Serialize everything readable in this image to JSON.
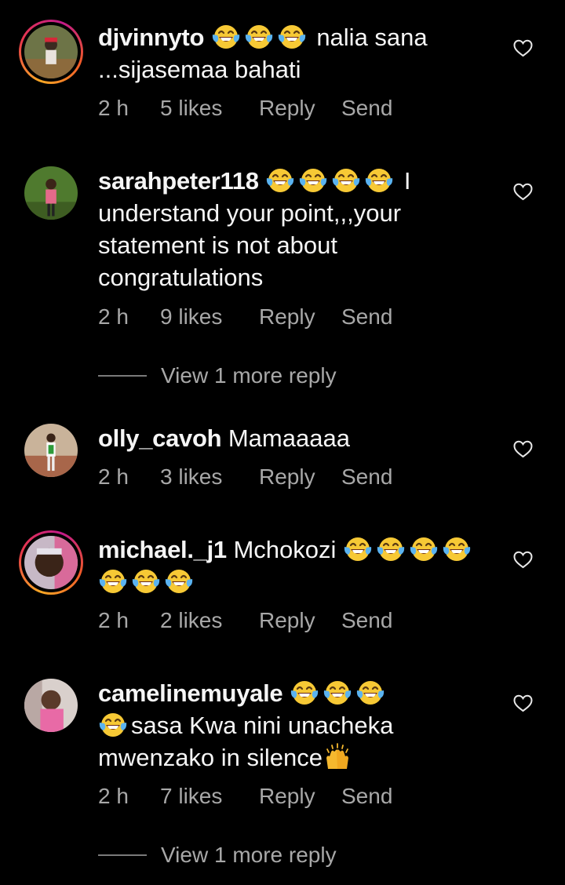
{
  "comments": [
    {
      "username": "djvinnyto",
      "text_before": "",
      "emojis_inline": 3,
      "text": " nalia sana ...sijasemaa bahati",
      "time": "2 h",
      "likes": "5 likes",
      "reply": "Reply",
      "send": "Send",
      "has_story_ring": true
    },
    {
      "username": "sarahpeter118",
      "emojis_inline": 4,
      "text": " I understand your point,,,your statement is not about congratulations",
      "time": "2 h",
      "likes": "9 likes",
      "reply": "Reply",
      "send": "Send",
      "view_more": "View 1 more reply",
      "has_story_ring": false
    },
    {
      "username": "olly_cavoh",
      "text": " Mamaaaaa",
      "time": "2 h",
      "likes": "3 likes",
      "reply": "Reply",
      "send": "Send",
      "has_story_ring": false
    },
    {
      "username": "michael._j1",
      "text": " Mchokozi ",
      "time": "2 h",
      "likes": "2 likes",
      "reply": "Reply",
      "send": "Send",
      "has_story_ring": true
    },
    {
      "username": "camelinemuyale",
      "text": "sasa Kwa nini unacheka mwenzako in silence",
      "time": "2 h",
      "likes": "7 likes",
      "reply": "Reply",
      "send": "Send",
      "view_more": "View 1 more reply",
      "has_story_ring": false
    }
  ],
  "icons": {
    "like": "heart-outline-icon",
    "laugh": "face-with-tears-of-joy-emoji",
    "praise": "raising-hands-emoji"
  },
  "colors": {
    "background": "#000000",
    "text": "#f5f5f5",
    "secondary": "#a8a8a8"
  }
}
